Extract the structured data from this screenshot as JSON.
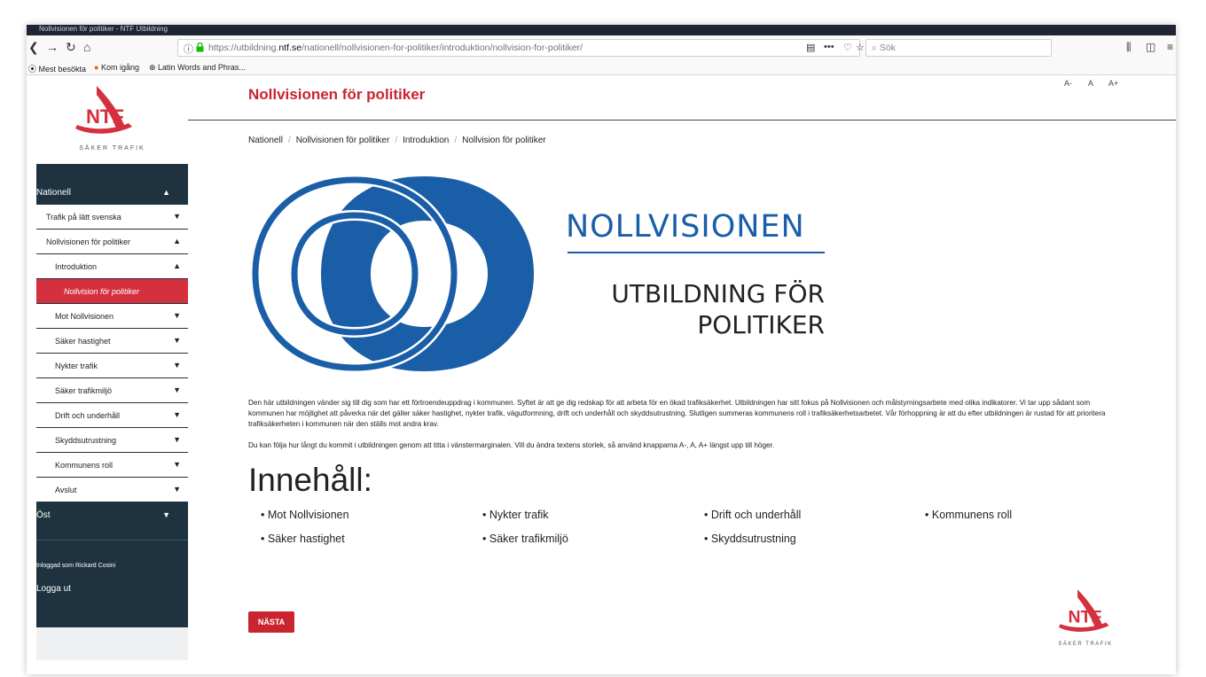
{
  "browser": {
    "tab_title": "Nollvisionen för politiker - NTF Utbildning",
    "url_prefix": "https://utbildning.",
    "url_domain": "ntf.se",
    "url_path": "/nationell/nollvisionen-for-politiker/introduktion/nollvision-for-politiker/",
    "search_placeholder": "Sök",
    "bookmarks": [
      "Mest besökta",
      "Kom igång",
      "Latin Words and Phras..."
    ]
  },
  "brand": {
    "logo_text": "NTF",
    "tagline": "SÄKER TRAFIK"
  },
  "sidebar": {
    "top": [
      {
        "label": "Nationell",
        "state": "expanded"
      },
      {
        "label": "Öst",
        "state": "collapsed"
      }
    ],
    "items": [
      {
        "label": "Trafik på lätt svenska"
      },
      {
        "label": "Nollvisionen för politiker"
      },
      {
        "label": "Introduktion"
      },
      {
        "label": "Nollvision för politiker"
      },
      {
        "label": "Mot Nollvisionen"
      },
      {
        "label": "Säker hastighet"
      },
      {
        "label": "Nykter trafik"
      },
      {
        "label": "Säker trafikmiljö"
      },
      {
        "label": "Drift och underhåll"
      },
      {
        "label": "Skyddsutrustning"
      },
      {
        "label": "Kommunens roll"
      },
      {
        "label": "Avslut"
      }
    ],
    "logged_in": "Inloggad som Rickard Cosini",
    "logout": "Logga ut"
  },
  "header": {
    "title": "Nollvisionen för politiker",
    "font_small": "A-",
    "font_normal": "A",
    "font_large": "A+"
  },
  "breadcrumb": [
    "Nationell",
    "Nollvisionen för politiker",
    "Introduktion",
    "Nollvision för politiker"
  ],
  "hero": {
    "title": "NOLLVISIONEN",
    "subtitle_line1": "UTBILDNING FÖR",
    "subtitle_line2": "POLITIKER",
    "brand_color": "#1a5ea8"
  },
  "intro": {
    "p1": "Den här utbildningen vänder sig till dig som har ett förtroendeuppdrag i kommunen. Syftet är att ge dig redskap för att arbeta för en ökad trafiksäkerhet. Utbildningen har sitt fokus på Nollvisionen och målstyrningsarbete med olika indikatorer. Vi tar upp sådant som kommunen har möjlighet att påverka när det gäller säker hastighet, nykter trafik, vägutformning, drift och underhåll och skyddsutrustning. Slutligen summeras kommunens roll i trafiksäkerhetsarbetet. Vår förhoppning är att du efter utbildningen är rustad för att prioritera trafiksäkerheten i kommunen när den ställs mot andra krav.",
    "p2": "Du kan följa hur långt du kommit i utbildningen genom att titta i vänstermarginalen. Vill du ändra textens storlek, så använd knapparna A-, A, A+ längst upp till höger."
  },
  "toc": {
    "heading": "Innehåll:",
    "items": [
      "Mot Nollvisionen",
      "Nykter trafik",
      "Drift och underhåll",
      "Kommunens roll",
      "Säker hastighet",
      "Säker trafikmiljö",
      "Skyddsutrustning"
    ]
  },
  "next_button": "NÄSTA",
  "accent_color": "#c9242f"
}
